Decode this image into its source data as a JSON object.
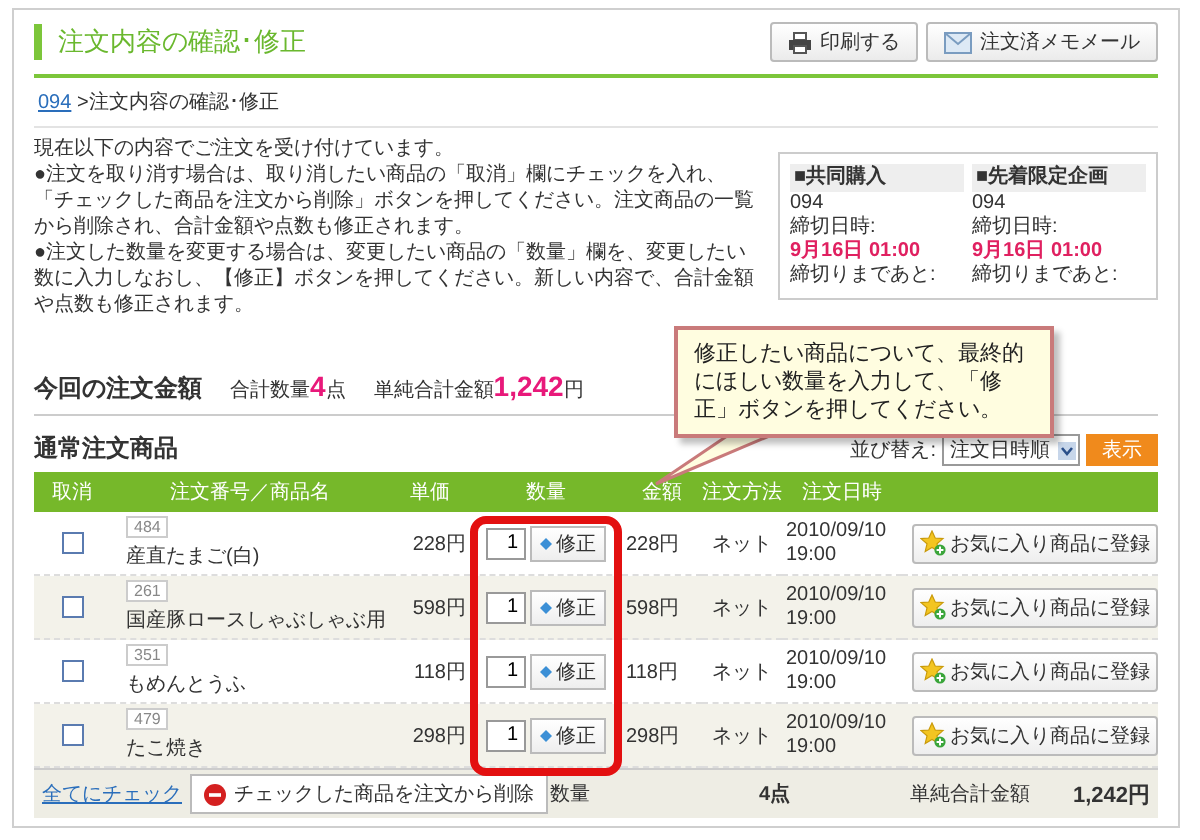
{
  "header": {
    "title": "注文内容の確認･修正",
    "buttons": [
      {
        "kind": "print",
        "label": "印刷する"
      },
      {
        "kind": "mail",
        "label": "注文済メモメール"
      }
    ]
  },
  "breadcrumb": {
    "link": "094",
    "separator": ">",
    "current": "注文内容の確認･修正"
  },
  "notice": [
    "現在以下の内容でご注文を受け付けています。",
    "●注文を取り消す場合は、取り消したい商品の「取消」欄にチェックを入れ、「チェックした商品を注文から削除」ボタンを押してください。注文商品の一覧から削除され、合計金額や点数も修正されます。",
    "●注文した数量を変更する場合は、変更したい商品の「数量」欄を、変更したい数に入力しなおし、【修正】ボタンを押してください。新しい内容で、合計金額や点数も修正されます。"
  ],
  "info_box": [
    {
      "heading": "■共同購入",
      "number": "094",
      "deadline_label": "締切日時:",
      "deadline": "9月16日 01:00",
      "remaining_label": "締切りまであと:"
    },
    {
      "heading": "■先着限定企画",
      "number": "094",
      "deadline_label": "締切日時:",
      "deadline": "9月16日 01:00",
      "remaining_label": "締切りまであと:"
    }
  ],
  "callout": "修正したい商品について、最終的にほしい数量を入力して、「修正」ボタンを押してください。",
  "summary": {
    "title": "今回の注文金額",
    "qty_label": "合計数量",
    "qty": "4",
    "qty_unit": "点",
    "total_label": "単純合計金額",
    "total": "1,242",
    "total_unit": "円"
  },
  "section_title": "通常注文商品",
  "sort": {
    "label": "並び替え:",
    "value": "注文日時順",
    "button": "表示"
  },
  "table": {
    "columns": [
      "取消",
      "注文番号／商品名",
      "単価",
      "数量",
      "金額",
      "注文方法",
      "注文日時"
    ],
    "rows": [
      {
        "checked": false,
        "code": "484",
        "name": "産直たまご(白)",
        "price": "228円",
        "qty": "1",
        "fix": "修正",
        "amount": "228円",
        "method": "ネット",
        "date": "2010/09/10",
        "time": "19:00",
        "fav": "お気に入り商品に登録"
      },
      {
        "checked": false,
        "code": "261",
        "name": "国産豚ロースしゃぶしゃぶ用",
        "price": "598円",
        "qty": "1",
        "fix": "修正",
        "amount": "598円",
        "method": "ネット",
        "date": "2010/09/10",
        "time": "19:00",
        "fav": "お気に入り商品に登録"
      },
      {
        "checked": false,
        "code": "351",
        "name": "もめんとうふ",
        "price": "118円",
        "qty": "1",
        "fix": "修正",
        "amount": "118円",
        "method": "ネット",
        "date": "2010/09/10",
        "time": "19:00",
        "fav": "お気に入り商品に登録"
      },
      {
        "checked": false,
        "code": "479",
        "name": "たこ焼き",
        "price": "298円",
        "qty": "1",
        "fix": "修正",
        "amount": "298円",
        "method": "ネット",
        "date": "2010/09/10",
        "time": "19:00",
        "fav": "お気に入り商品に登録"
      }
    ]
  },
  "footer": {
    "check_all": "全てにチェック",
    "delete_button": "チェックした商品を注文から削除",
    "qty_label": "数量",
    "qty": "4点",
    "total_label": "単純合計金額",
    "total": "1,242円"
  }
}
